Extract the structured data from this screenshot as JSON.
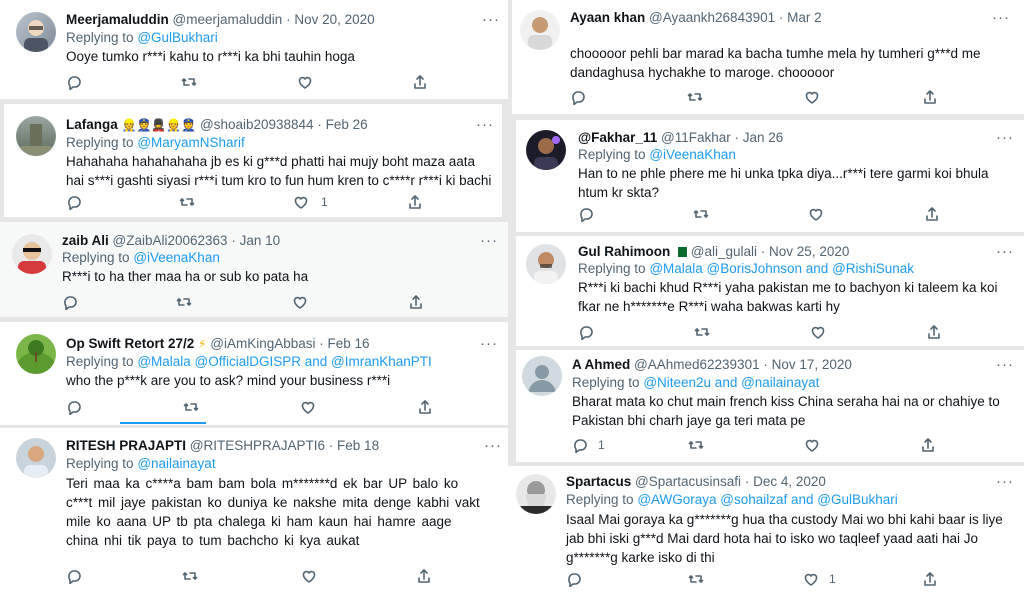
{
  "icons": {
    "reply": "reply-icon",
    "retweet": "retweet-icon",
    "like": "like-icon",
    "share": "share-icon",
    "more": "more-icon"
  },
  "colors": {
    "link": "#1d9bf0",
    "muted": "#536471",
    "text": "#0f1419"
  },
  "tweets": [
    {
      "name": "Meerjamaluddin",
      "handle": "@meerjamaluddin",
      "date": "· Nov 20, 2020",
      "replying_label": "Replying to",
      "replying_to": "@GulBukhari",
      "text": "Ooye tumko r***i kahu to r***i ka bhi tauhin hoga",
      "reply_count": "",
      "like_count": ""
    },
    {
      "name": "Lafanga",
      "handle": "@shoaib20938844",
      "date": "· Feb 26",
      "replying_label": "Replying to",
      "replying_to": "@MaryamNSharif",
      "text": "Hahahaha hahahahaha jb es ki g***d phatti hai mujy boht maza aata hai s***i gashti siyasi r***i tum kro to fun hum kren to c****r r***i ki bachi",
      "reply_count": "",
      "like_count": "1"
    },
    {
      "name": "zaib Ali",
      "handle": "@ZaibAli20062363",
      "date": "· Jan 10",
      "replying_label": "Replying to",
      "replying_to": "@iVeenaKhan",
      "text": "R***i to ha ther maa ha or sub ko pata ha",
      "reply_count": "",
      "like_count": ""
    },
    {
      "name": "Op Swift Retort 27/2",
      "handle": "@iAmKingAbbasi",
      "date": "· Feb 16",
      "replying_label": "Replying to",
      "replying_to": "@Malala @OfficialDGISPR and @ImranKhanPTI",
      "text": "who the p***k are you to ask? mind your business r***i",
      "reply_count": "",
      "like_count": ""
    },
    {
      "name": "RITESH PRAJAPTI",
      "handle": "@RITESHPRAJAPTI6",
      "date": "· Feb 18",
      "replying_label": "Replying to",
      "replying_to": "@nailainayat",
      "text": "Teri maa ka c****a bam bam bola m*******d ek bar UP balo ko c***t mil jaye pakistan ko duniya ke nakshe mita denge kabhi vakt mile ko aana UP tb pta chalega ki ham kaun hai hamre aage china nhi tik paya to tum bachcho ki kya aukat",
      "reply_count": "",
      "like_count": ""
    },
    {
      "name": "Ayaan khan",
      "handle": "@Ayaankh26843901",
      "date": "· Mar 2",
      "replying_label": "",
      "replying_to": "",
      "text": "chooooor pehli bar marad ka bacha tumhe mela hy tumheri g***d me dandaghusa hychakhe to maroge. chooooor",
      "reply_count": "",
      "like_count": ""
    },
    {
      "name": "@Fakhar_11",
      "handle": "@11Fakhar",
      "date": "· Jan 26",
      "replying_label": "Replying to",
      "replying_to": "@iVeenaKhan",
      "text": "Han to ne phle phere me hi unka tpka diya...r***i tere garmi koi bhula htum kr skta?",
      "reply_count": "",
      "like_count": ""
    },
    {
      "name": "Gul Rahimoon",
      "handle": "@ali_gulali",
      "date": "· Nov 25, 2020",
      "replying_label": "Replying to",
      "replying_to": "@Malala @BorisJohnson and @RishiSunak",
      "text": "R***i ki bachi khud R***i yaha pakistan me to bachyon ki taleem ka koi fkar ne h*******e R***i waha bakwas karti hy",
      "reply_count": "",
      "like_count": ""
    },
    {
      "name": "A Ahmed",
      "handle": "@AAhmed62239301",
      "date": "· Nov 17, 2020",
      "replying_label": "Replying to",
      "replying_to": "@Niteen2u and @nailainayat",
      "text": "Bharat mata ko chut main french kiss China seraha hai na or chahiye to Pakistan bhi charh jaye ga teri mata pe",
      "reply_count": "1",
      "like_count": ""
    },
    {
      "name": "Spartacus",
      "handle": "@Spartacusinsafi",
      "date": "· Dec 4, 2020",
      "replying_label": "Replying to",
      "replying_to": "@AWGoraya @sohailzaf and @GulBukhari",
      "text": "Isaal Mai goraya ka g*******g hua tha custody Mai wo bhi kahi baar is liye jab bhi iski g***d Mai dard hota hai to isko wo taqleef yaad aati hai Jo g*******g karke isko di thi",
      "reply_count": "",
      "like_count": "1"
    }
  ]
}
